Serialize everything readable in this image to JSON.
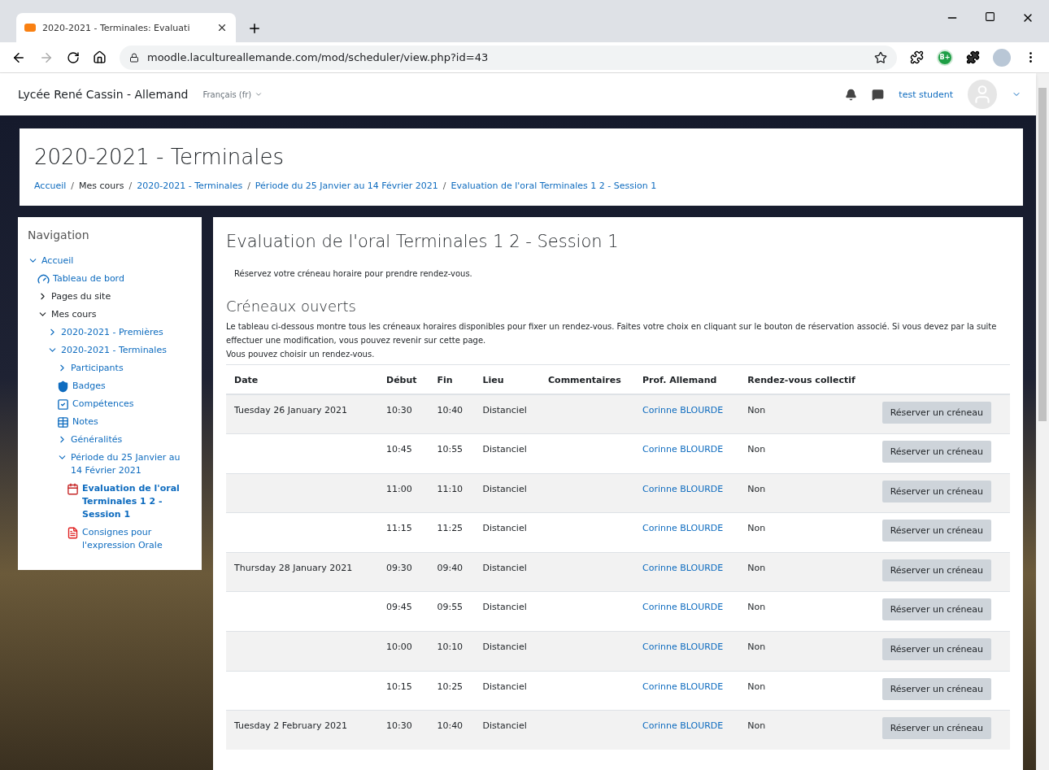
{
  "browser": {
    "tab_title": "2020-2021 - Terminales: Evaluati",
    "url": "moodle.lacultureallemande.com/mod/scheduler/view.php?id=43",
    "extension_badge": "B+"
  },
  "navbar": {
    "site_name": "Lycée René Cassin - Allemand",
    "language": "Français (fr)",
    "user_name": "test student"
  },
  "header": {
    "title": "2020-2021 - Terminales",
    "breadcrumb": [
      {
        "label": "Accueil",
        "link": true
      },
      {
        "separator": "/",
        "label": "Mes cours",
        "link": false
      },
      {
        "separator": "/",
        "label": "2020-2021 - Terminales",
        "link": true
      },
      {
        "separator": "/",
        "label": "Période du 25 Janvier au 14 Février 2021",
        "link": true
      },
      {
        "separator": "/",
        "label": "Evaluation de l'oral Terminales 1 2 - Session 1",
        "link": true
      }
    ]
  },
  "navigation": {
    "title": "Navigation",
    "items": [
      {
        "label": "Accueil",
        "kind": "branch",
        "expanded": true,
        "link": true,
        "selected": false,
        "children": [
          {
            "label": "Tableau de bord",
            "kind": "dashboard",
            "link": true,
            "selected": false
          },
          {
            "label": "Pages du site",
            "kind": "branch",
            "expanded": false,
            "link": false,
            "selected": false
          },
          {
            "label": "Mes cours",
            "kind": "branch",
            "expanded": true,
            "link": false,
            "selected": false,
            "children": [
              {
                "label": "2020-2021 - Premières",
                "kind": "branch",
                "expanded": false,
                "link": true,
                "selected": false
              },
              {
                "label": "2020-2021 - Terminales",
                "kind": "branch",
                "expanded": true,
                "link": true,
                "selected": false,
                "children": [
                  {
                    "label": "Participants",
                    "kind": "branch",
                    "expanded": false,
                    "link": true,
                    "selected": false
                  },
                  {
                    "label": "Badges",
                    "kind": "badges",
                    "link": true,
                    "selected": false
                  },
                  {
                    "label": "Compétences",
                    "kind": "competencies",
                    "link": true,
                    "selected": false
                  },
                  {
                    "label": "Notes",
                    "kind": "grades",
                    "link": true,
                    "selected": false
                  },
                  {
                    "label": "Généralités",
                    "kind": "branch",
                    "expanded": false,
                    "link": true,
                    "selected": false
                  },
                  {
                    "label": "Période du 25 Janvier au 14 Février 2021",
                    "kind": "branch",
                    "expanded": true,
                    "link": true,
                    "selected": false,
                    "children": [
                      {
                        "label": "Evaluation de l'oral Terminales 1 2 - Session 1",
                        "kind": "scheduler",
                        "link": true,
                        "selected": true
                      },
                      {
                        "label": "Consignes pour l'expression Orale",
                        "kind": "pdf",
                        "link": true,
                        "selected": false
                      }
                    ]
                  }
                ]
              }
            ]
          }
        ]
      }
    ]
  },
  "main": {
    "title": "Evaluation de l'oral Terminales 1 2 - Session 1",
    "intro": "Réservez votre créneau horaire pour prendre rendez-vous.",
    "section_title": "Créneaux ouverts",
    "description": "Le tableau ci-dessous montre tous les créneaux horaires disponibles pour fixer un rendez-vous. Faites votre choix en cliquant sur le bouton de réservation associé. Si vous devez par la suite effectuer une modification, vous pouvez revenir sur cette page.",
    "note": "Vous pouvez choisir un rendez-vous.",
    "table": {
      "columns": [
        "Date",
        "Début",
        "Fin",
        "Lieu",
        "Commentaires",
        "Prof. Allemand",
        "Rendez-vous collectif"
      ],
      "rows": [
        {
          "date": "Tuesday 26 January 2021",
          "start": "10:30",
          "end": "10:40",
          "place": "Distanciel",
          "teacher": "Corinne BLOURDE",
          "group": "Non",
          "action": "Réserver un créneau"
        },
        {
          "start": "10:45",
          "end": "10:55",
          "place": "Distanciel",
          "teacher": "Corinne BLOURDE",
          "group": "Non",
          "action": "Réserver un créneau"
        },
        {
          "start": "11:00",
          "end": "11:10",
          "place": "Distanciel",
          "teacher": "Corinne BLOURDE",
          "group": "Non",
          "action": "Réserver un créneau"
        },
        {
          "start": "11:15",
          "end": "11:25",
          "place": "Distanciel",
          "teacher": "Corinne BLOURDE",
          "group": "Non",
          "action": "Réserver un créneau"
        },
        {
          "date": "Thursday 28 January 2021",
          "start": "09:30",
          "end": "09:40",
          "place": "Distanciel",
          "teacher": "Corinne BLOURDE",
          "group": "Non",
          "action": "Réserver un créneau"
        },
        {
          "start": "09:45",
          "end": "09:55",
          "place": "Distanciel",
          "teacher": "Corinne BLOURDE",
          "group": "Non",
          "action": "Réserver un créneau"
        },
        {
          "start": "10:00",
          "end": "10:10",
          "place": "Distanciel",
          "teacher": "Corinne BLOURDE",
          "group": "Non",
          "action": "Réserver un créneau"
        },
        {
          "start": "10:15",
          "end": "10:25",
          "place": "Distanciel",
          "teacher": "Corinne BLOURDE",
          "group": "Non",
          "action": "Réserver un créneau"
        },
        {
          "date": "Tuesday 2 February 2021",
          "start": "10:30",
          "end": "10:40",
          "place": "Distanciel",
          "teacher": "Corinne BLOURDE",
          "group": "Non",
          "action": "Réserver un créneau"
        }
      ]
    }
  }
}
